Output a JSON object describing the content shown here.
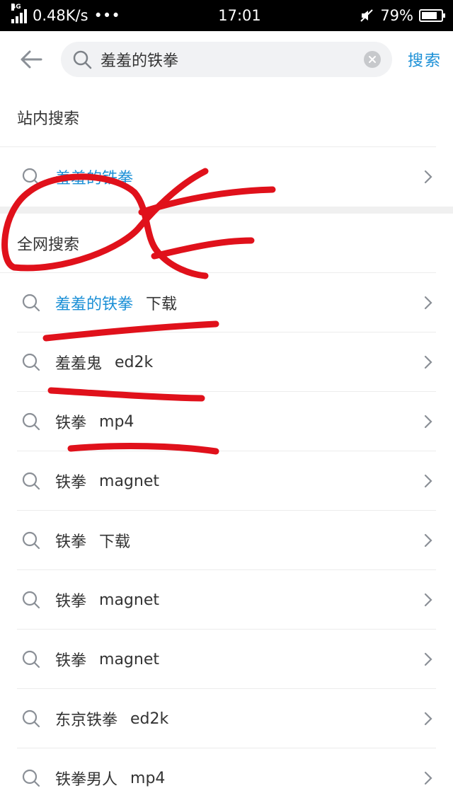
{
  "status": {
    "network": "4G",
    "speed": "0.48K/s",
    "dots": "•••",
    "time": "17:01",
    "battery": "79%",
    "battery_level": 0.79
  },
  "search": {
    "query": "羞羞的铁拳",
    "button": "搜索"
  },
  "site_search": {
    "title": "站内搜索",
    "items": [
      {
        "cn": "羞羞的铁拳",
        "en": ""
      }
    ]
  },
  "web_search": {
    "title": "全网搜索",
    "items": [
      {
        "cn": "羞羞的铁拳",
        "extra_cn": "下载",
        "en": ""
      },
      {
        "cn": "羞羞鬼",
        "extra_cn": "",
        "en": "ed2k"
      },
      {
        "cn": "铁拳",
        "extra_cn": "",
        "en": "mp4"
      },
      {
        "cn": "铁拳",
        "extra_cn": "",
        "en": "magnet"
      },
      {
        "cn": "铁拳",
        "extra_cn": "下载",
        "en": ""
      },
      {
        "cn": "铁拳",
        "extra_cn": "",
        "en": "magnet"
      },
      {
        "cn": "铁拳",
        "extra_cn": "",
        "en": "magnet"
      },
      {
        "cn": "东京铁拳",
        "extra_cn": "",
        "en": "ed2k"
      },
      {
        "cn": "铁拳男人",
        "extra_cn": "",
        "en": "mp4"
      }
    ]
  },
  "colors": {
    "accent": "#1a8fd6",
    "annotation": "#e0111b"
  }
}
